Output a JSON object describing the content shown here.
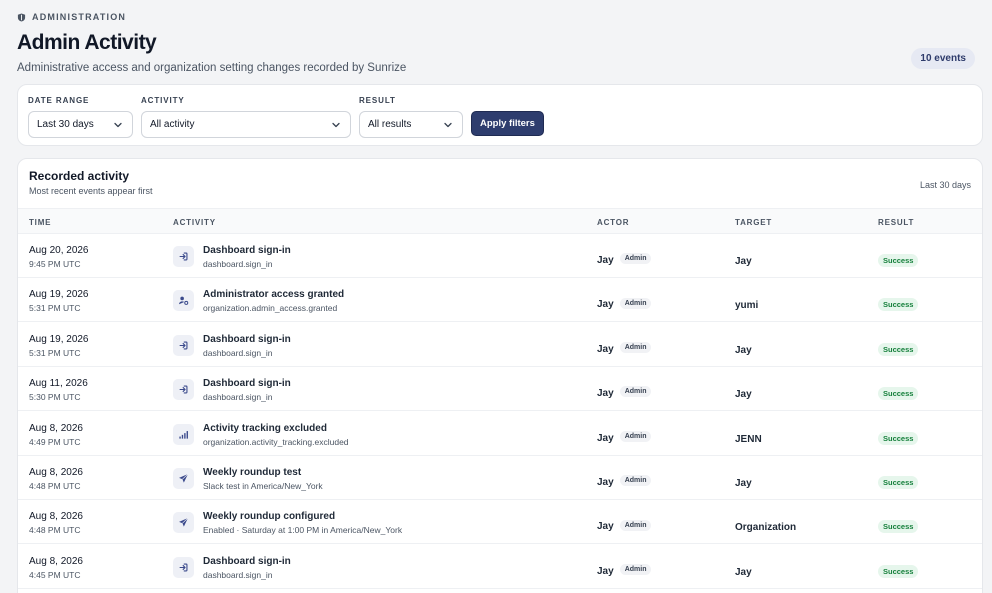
{
  "header": {
    "eyebrow": "ADMINISTRATION",
    "title": "Admin Activity",
    "subtitle": "Administrative access and organization setting changes recorded by Sunrize",
    "event_count": "10 events"
  },
  "filters": {
    "date_range": {
      "label": "DATE RANGE",
      "value": "Last 30 days"
    },
    "activity": {
      "label": "ACTIVITY",
      "value": "All activity"
    },
    "result": {
      "label": "RESULT",
      "value": "All results"
    },
    "apply_label": "Apply filters"
  },
  "activity_card": {
    "title": "Recorded activity",
    "subtitle": "Most recent events appear first",
    "range": "Last 30 days",
    "columns": {
      "time": "TIME",
      "activity": "ACTIVITY",
      "actor": "ACTOR",
      "target": "TARGET",
      "result": "RESULT"
    },
    "rows": [
      {
        "date": "Aug 20, 2026",
        "clock": "9:45 PM UTC",
        "icon": "sign-in-icon",
        "title": "Dashboard sign-in",
        "code": "dashboard.sign_in",
        "actor": "Jay",
        "role": "Admin",
        "target": "Jay",
        "result": "Success"
      },
      {
        "date": "Aug 19, 2026",
        "clock": "5:31 PM UTC",
        "icon": "user-gear-icon",
        "title": "Administrator access granted",
        "code": "organization.admin_access.granted",
        "actor": "Jay",
        "role": "Admin",
        "target": "yumi",
        "result": "Success"
      },
      {
        "date": "Aug 19, 2026",
        "clock": "5:31 PM UTC",
        "icon": "sign-in-icon",
        "title": "Dashboard sign-in",
        "code": "dashboard.sign_in",
        "actor": "Jay",
        "role": "Admin",
        "target": "Jay",
        "result": "Success"
      },
      {
        "date": "Aug 11, 2026",
        "clock": "5:30 PM UTC",
        "icon": "sign-in-icon",
        "title": "Dashboard sign-in",
        "code": "dashboard.sign_in",
        "actor": "Jay",
        "role": "Admin",
        "target": "Jay",
        "result": "Success"
      },
      {
        "date": "Aug 8, 2026",
        "clock": "4:49 PM UTC",
        "icon": "signal-bars-icon",
        "title": "Activity tracking excluded",
        "code": "organization.activity_tracking.excluded",
        "actor": "Jay",
        "role": "Admin",
        "target": "JENN",
        "result": "Success"
      },
      {
        "date": "Aug 8, 2026",
        "clock": "4:48 PM UTC",
        "icon": "paper-plane-icon",
        "title": "Weekly roundup test",
        "code": "Slack test in America/New_York",
        "actor": "Jay",
        "role": "Admin",
        "target": "Jay",
        "result": "Success"
      },
      {
        "date": "Aug 8, 2026",
        "clock": "4:48 PM UTC",
        "icon": "paper-plane-icon",
        "title": "Weekly roundup configured",
        "code": "Enabled · Saturday at 1:00 PM in America/New_York",
        "actor": "Jay",
        "role": "Admin",
        "target": "Organization",
        "result": "Success"
      },
      {
        "date": "Aug 8, 2026",
        "clock": "4:45 PM UTC",
        "icon": "sign-in-icon",
        "title": "Dashboard sign-in",
        "code": "dashboard.sign_in",
        "actor": "Jay",
        "role": "Admin",
        "target": "Jay",
        "result": "Success"
      }
    ]
  },
  "colors": {
    "accent": "#2e3d6e",
    "success_text": "#16803c",
    "success_bg": "#e6f6ec",
    "icon_tint": "#3b4a8c"
  }
}
